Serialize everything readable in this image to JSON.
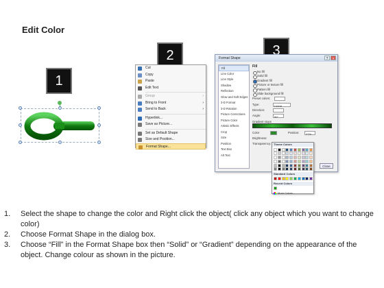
{
  "title": "Edit Color",
  "steps_badges": [
    "1",
    "2",
    "3"
  ],
  "context_menu": {
    "items": [
      {
        "label": "Cut",
        "icon": "scissors-icon",
        "color": "#3a6fb0",
        "state": "normal",
        "submenu": false
      },
      {
        "label": "Copy",
        "icon": "copy-icon",
        "color": "#6b8fc4",
        "state": "normal",
        "submenu": false
      },
      {
        "label": "Paste",
        "icon": "paste-icon",
        "color": "#c9a24a",
        "state": "normal",
        "submenu": false
      },
      {
        "label": "Edit Text",
        "icon": "edit-text-icon",
        "color": "#555555",
        "state": "normal",
        "submenu": false
      },
      {
        "label": "Group",
        "icon": "group-icon",
        "color": "#aaaaaa",
        "state": "disabled",
        "submenu": true
      },
      {
        "label": "Bring to Front",
        "icon": "bring-front-icon",
        "color": "#4a7cc0",
        "state": "normal",
        "submenu": true
      },
      {
        "label": "Send to Back",
        "icon": "send-back-icon",
        "color": "#4a7cc0",
        "state": "normal",
        "submenu": true
      },
      {
        "label": "Hyperlink...",
        "icon": "hyperlink-icon",
        "color": "#2d6bb5",
        "state": "normal",
        "submenu": false
      },
      {
        "label": "Save as Picture...",
        "icon": "save-picture-icon",
        "color": "#777777",
        "state": "normal",
        "submenu": false
      },
      {
        "label": "Set as Default Shape",
        "icon": "default-shape-icon",
        "color": "#777777",
        "state": "normal",
        "submenu": false
      },
      {
        "label": "Size and Position...",
        "icon": "size-position-icon",
        "color": "#777777",
        "state": "normal",
        "submenu": false
      },
      {
        "label": "Format Shape...",
        "icon": "format-shape-icon",
        "color": "#c8922c",
        "state": "highlighted",
        "submenu": false
      }
    ]
  },
  "format_dialog": {
    "title": "Format Shape",
    "categories": [
      "Fill",
      "Line Color",
      "Line Style",
      "Shadow",
      "Reflection",
      "Glow and Soft Edges",
      "3-D Format",
      "3-D Rotation",
      "Picture Corrections",
      "Picture Color",
      "Artistic Effects",
      "Crop",
      "Size",
      "Position",
      "Text Box",
      "Alt Text"
    ],
    "selected_category": "Fill",
    "panel_heading": "Fill",
    "fill_options": [
      "No fill",
      "Solid fill",
      "Gradient fill",
      "Picture or texture fill",
      "Pattern fill",
      "Slide background fill"
    ],
    "selected_fill": "Gradient fill",
    "labels": {
      "preset": "Preset colors:",
      "type": "Type:",
      "type_value": "Linear",
      "direction": "Direction:",
      "angle": "Angle:",
      "angle_value": "90°",
      "stops": "Gradient stops",
      "color": "Color",
      "position": "Position:",
      "position_value": "27%",
      "brightness": "Brightness:",
      "transparency": "Transparency:"
    },
    "close_label": "Close"
  },
  "palette": {
    "theme_label": "Theme Colors",
    "standard_label": "Standard Colors",
    "recent_label": "Recent Colors",
    "more_label": "More Colors...",
    "theme_top": [
      "#ffffff",
      "#000000",
      "#eeece1",
      "#1f497d",
      "#4f81bd",
      "#c0504d",
      "#9bbb59",
      "#8064a2",
      "#4bacc6",
      "#f79646"
    ],
    "standard": [
      "#c00000",
      "#ff0000",
      "#ffc000",
      "#ffff00",
      "#92d050",
      "#00b050",
      "#00b0f0",
      "#0070c0",
      "#002060",
      "#7030a0"
    ],
    "recent": [
      "#00a000"
    ]
  },
  "instructions": [
    {
      "num": "1.",
      "text": "Select the shape to change the color and Right click the object( click any object which you want to change color)"
    },
    {
      "num": "2.",
      "text": "Choose Format Shape in the dialog box."
    },
    {
      "num": "3.",
      "text": "Choose “Fill” in the Format Shape box then “Solid” or “Gradient” depending on the appearance of the object. Change colour as shown in the picture."
    }
  ]
}
